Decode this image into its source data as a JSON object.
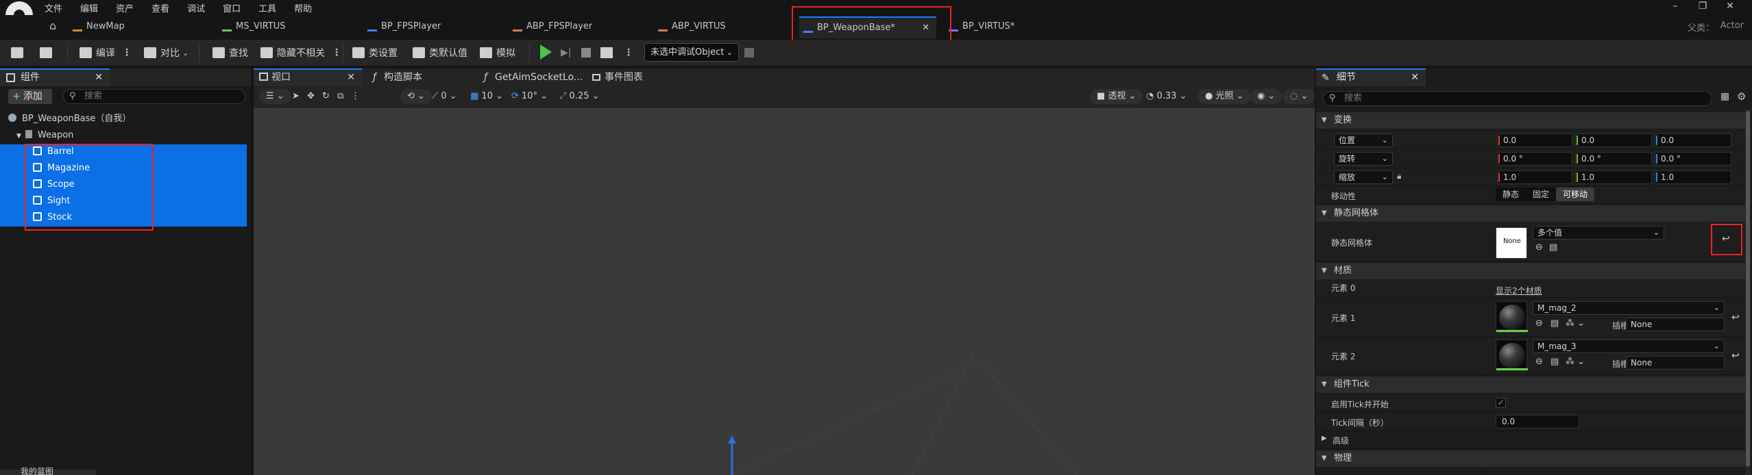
{
  "menu": [
    "文件",
    "编辑",
    "资产",
    "查看",
    "调试",
    "窗口",
    "工具",
    "帮助"
  ],
  "tabs": [
    {
      "label": "NewMap",
      "color": "#e08a2a"
    },
    {
      "label": "MS_VIRTUS",
      "color": "#6ac46a"
    },
    {
      "label": "BP_FPSPlayer",
      "color": "#4a7dff"
    },
    {
      "label": "ABP_FPSPlayer",
      "color": "#d08050"
    },
    {
      "label": "ABP_VIRTUS",
      "color": "#d08050"
    },
    {
      "label": "BP_WeaponBase*",
      "color": "#4a7dff"
    },
    {
      "label": "BP_VIRTUS*",
      "color": "#7c6cff"
    }
  ],
  "parent": {
    "label": "父类：",
    "value": "Actor"
  },
  "toolbar": {
    "compile": "编译",
    "diff": "对比",
    "find": "查找",
    "hide_unrelated": "隐藏不相关",
    "class_settings": "类设置",
    "class_defaults": "类默认值",
    "simulate": "模拟",
    "debug_object": "未选中调试Object"
  },
  "components": {
    "tab": "组件",
    "add": "添加",
    "search_placeholder": "搜索",
    "root": "BP_WeaponBase（自我）",
    "weapon": "Weapon",
    "children": [
      "Barrel",
      "Magazine",
      "Scope",
      "Sight",
      "Stock"
    ]
  },
  "bottom_tab": "我的蓝图",
  "viewport_tabs": {
    "viewport": "视口",
    "construction": "构造脚本",
    "function": "GetAimSocketLo...",
    "event_graph": "事件图表"
  },
  "viewport_toolbar": {
    "angle": "0",
    "grid": "10",
    "rot_snap": "10°",
    "scale_snap": "0.25",
    "perspective": "透视",
    "fov": "0.33",
    "lighting": "光照"
  },
  "details": {
    "tab": "细节",
    "search_placeholder": "搜索",
    "transform_section": "变换",
    "location": {
      "label": "位置",
      "x": "0.0",
      "y": "0.0",
      "z": "0.0"
    },
    "rotation": {
      "label": "旋转",
      "x": "0.0 °",
      "y": "0.0 °",
      "z": "0.0 °"
    },
    "scale": {
      "label": "缩放",
      "x": "1.0",
      "y": "1.0",
      "z": "1.0"
    },
    "mobility": {
      "label": "移动性",
      "options": [
        "静态",
        "固定",
        "可移动"
      ]
    },
    "static_mesh_section": "静态网格体",
    "static_mesh": {
      "label": "静态网格体",
      "thumb": "None",
      "value": "多个值"
    },
    "materials_section": "材质",
    "element0": {
      "label": "元素 0",
      "link": "显示2个材质"
    },
    "element1": {
      "label": "元素 1",
      "value": "M_mag_2",
      "slot_label": "插槽",
      "slot_value": "None"
    },
    "element2": {
      "label": "元素 2",
      "value": "M_mag_3",
      "slot_label": "插槽",
      "slot_value": "None"
    },
    "tick_section": "组件Tick",
    "tick_enabled": {
      "label": "启用Tick并开始"
    },
    "tick_interval": {
      "label": "Tick间隔（秒）",
      "value": "0.0"
    },
    "advanced": "高级",
    "physics_section": "物理"
  }
}
